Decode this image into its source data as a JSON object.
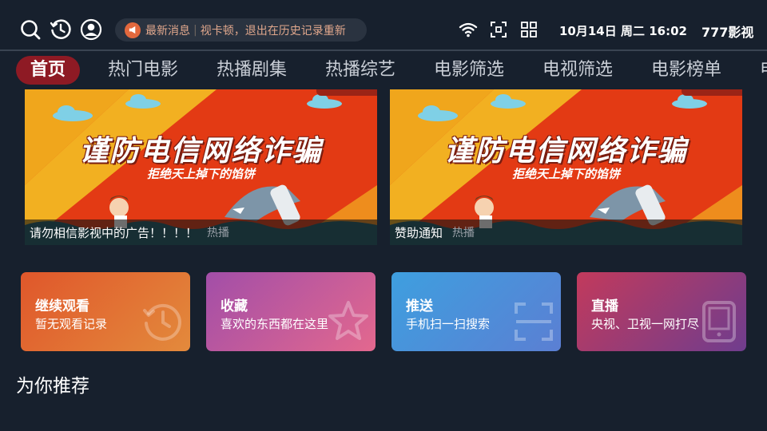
{
  "header": {
    "icons": [
      "search-icon",
      "history-icon",
      "user-icon"
    ],
    "ticker": {
      "label": "最新消息",
      "separator": "|",
      "text": "视卡顿，退出在历史记录重新"
    },
    "status_icons": [
      "wifi-icon",
      "scan-icon",
      "apps-icon"
    ],
    "datetime": "10月14日 周二 16:02",
    "brand": "777影视"
  },
  "nav": {
    "tabs": [
      {
        "label": "首页",
        "active": true
      },
      {
        "label": "热门电影"
      },
      {
        "label": "热播剧集"
      },
      {
        "label": "热播综艺"
      },
      {
        "label": "电影筛选"
      },
      {
        "label": "电视筛选"
      },
      {
        "label": "电影榜单"
      },
      {
        "label": "电"
      }
    ]
  },
  "banners": [
    {
      "headline": "谨防电信网络诈骗",
      "subhead": "拒绝天上掉下的馅饼",
      "caption": "请勿相信影视中的广告！！！！",
      "tag": "热播"
    },
    {
      "headline": "谨防电信网络诈骗",
      "subhead": "拒绝天上掉下的馅饼",
      "caption": "赞助通知",
      "tag": "热播"
    }
  ],
  "cards": [
    {
      "title": "继续观看",
      "subtitle": "暂无观看记录",
      "icon": "history-icon",
      "color_from": "#e0572b",
      "color_to": "#e38a3c"
    },
    {
      "title": "收藏",
      "subtitle": "喜欢的东西都在这里",
      "icon": "star-icon",
      "color_from": "#a24ea8",
      "color_to": "#e3688e"
    },
    {
      "title": "推送",
      "subtitle": "手机扫一扫搜索",
      "icon": "scan-icon",
      "color_from": "#3e9fdf",
      "color_to": "#5b7fd3"
    },
    {
      "title": "直播",
      "subtitle": "央视、卫视一网打尽",
      "icon": "tablet-icon",
      "color_from": "#c23a5c",
      "color_to": "#6f3d8e"
    }
  ],
  "section": {
    "title": "为你推荐"
  },
  "colors": {
    "background": "#17202d",
    "active_tab": "#8e1a24",
    "ticker_text": "#e0a78c"
  }
}
